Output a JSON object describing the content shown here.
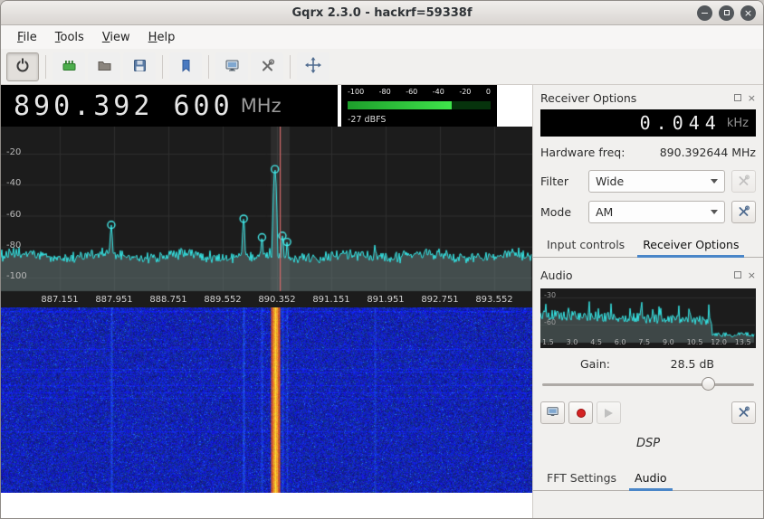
{
  "window": {
    "title": "Gqrx 2.3.0 - hackrf=59338f"
  },
  "window_controls": {
    "minimize_glyph": "−",
    "close_glyph": "×"
  },
  "menu": {
    "items": [
      "File",
      "Tools",
      "View",
      "Help"
    ]
  },
  "toolbar": {
    "icons": [
      "power-icon",
      "io-devices-icon",
      "open-folder-icon",
      "save-floppy-icon",
      "bookmarks-icon",
      "remote-control-icon",
      "tools-icon",
      "fullscreen-icon"
    ],
    "power_pressed": true
  },
  "frequency_display": {
    "value": "890.392 600",
    "unit": "MHz"
  },
  "meter": {
    "ticks": [
      "-100",
      "-80",
      "-60",
      "-40",
      "-20",
      "0"
    ],
    "value_label": "-27 dBFS",
    "level_percent": 73
  },
  "receiver": {
    "panel_title": "Receiver Options",
    "offset_value": "0.044",
    "offset_unit": "kHz",
    "hardware_freq_label": "Hardware freq:",
    "hardware_freq_value": "890.392644 MHz",
    "filter_label": "Filter",
    "filter_value": "Wide",
    "mode_label": "Mode",
    "mode_value": "AM",
    "tabs": [
      "Input controls",
      "Receiver Options"
    ],
    "active_tab": "Receiver Options"
  },
  "audio": {
    "panel_title": "Audio",
    "gain_label": "Gain:",
    "gain_value": "28.5 dB",
    "gain_slider_percent": 78,
    "dsp_label": "DSP",
    "tabs": [
      "FFT Settings",
      "Audio"
    ],
    "active_tab": "Audio"
  },
  "chart_data": [
    {
      "type": "line",
      "title": "RF spectrum",
      "x_ticks": [
        "887.151",
        "887.951",
        "888.751",
        "889.552",
        "890.352",
        "891.151",
        "891.951",
        "892.751",
        "893.552"
      ],
      "y_ticks": [
        "-20",
        "-40",
        "-60",
        "-80",
        "-100"
      ],
      "x_unit": "MHz",
      "y_unit": "dB",
      "ylim": [
        -110,
        0
      ],
      "noise_floor_db": -86,
      "tuned_line_mhz": 890.392,
      "peaks": [
        {
          "freq_mhz": 887.91,
          "db": -66,
          "w": 2.2,
          "marker": true
        },
        {
          "freq_mhz": 889.86,
          "db": -62,
          "w": 2.2,
          "marker": true
        },
        {
          "freq_mhz": 890.13,
          "db": -74,
          "w": 2.6,
          "marker": true
        },
        {
          "freq_mhz": 890.32,
          "db": -30,
          "w": 2.4,
          "marker": true
        },
        {
          "freq_mhz": 890.43,
          "db": -73,
          "w": 2.6,
          "marker": true
        },
        {
          "freq_mhz": 890.5,
          "db": -77,
          "w": 2.2,
          "marker": true
        },
        {
          "freq_mhz": 891.79,
          "db": -79,
          "w": 2.0,
          "marker": false
        }
      ]
    },
    {
      "type": "line",
      "title": "Audio spectrum",
      "x_ticks": [
        "1.5",
        "3.0",
        "4.5",
        "6.0",
        "7.5",
        "9.0",
        "10.5",
        "12.0",
        "13.5"
      ],
      "y_ticks": [
        "-30",
        "-60"
      ],
      "x_unit": "kHz",
      "y_unit": "dB"
    }
  ]
}
